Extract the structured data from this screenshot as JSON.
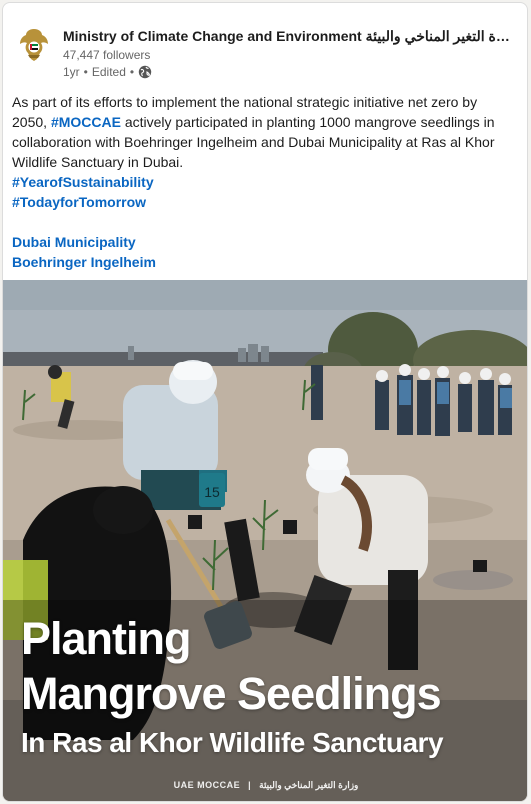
{
  "post": {
    "actor": {
      "name": "Ministry of Climate Change and Environment وزارة التغير المناخي والبيئة",
      "followers": "47,447 followers",
      "age": "1yr",
      "edited": "Edited",
      "visibility_icon": "globe-icon",
      "logo_icon": "uae-emblem-icon"
    },
    "text": {
      "paragraph_before": "As part of its efforts to implement the national strategic initiative net zero by 2050, ",
      "hashtag_moccae": "#MOCCAE",
      "paragraph_after": " actively participated in planting 1000 mangrove seedlings in collaboration with Boehringer Ingelheim and Dubai Municipality at Ras al Khor Wildlife Sanctuary in Dubai.",
      "hashtag_1": "#YearofSustainability",
      "hashtag_2": "#TodayforTomorrow",
      "mention_1": "Dubai Municipality",
      "mention_2": "Boehringer Ingelheim"
    },
    "image": {
      "title_line_1": "Planting",
      "title_line_2": "Mangrove Seedlings",
      "title_line_3": "In Ras al Khor Wildlife Sanctuary",
      "brand_en": "UAE MOCCAE",
      "brand_separator": "|",
      "brand_ar": "وزارة التغير المناخي والبيئة",
      "badge_number": "15"
    }
  },
  "colors": {
    "link": "#0a66c2",
    "text": "#1d1d1d",
    "muted": "#666666",
    "card_bg": "#ffffff",
    "page_bg": "#f3f2ef"
  }
}
